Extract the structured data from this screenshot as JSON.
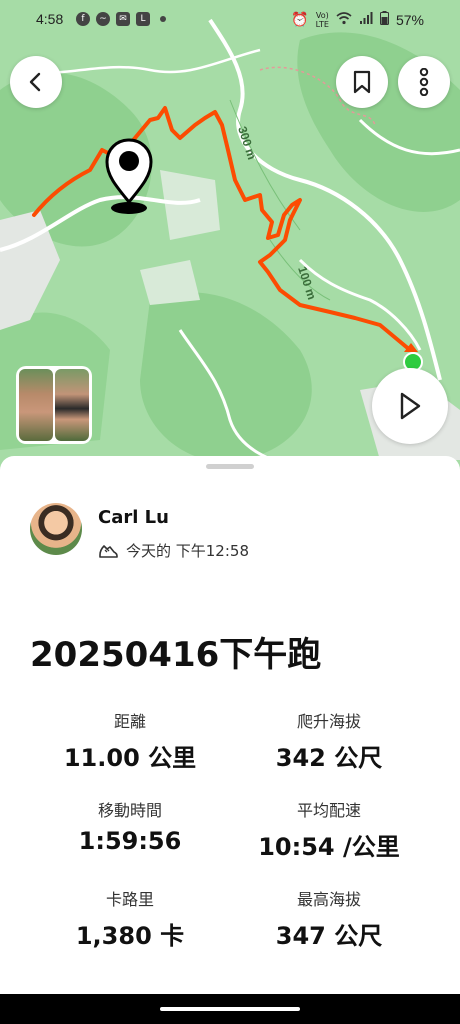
{
  "status_bar": {
    "time": "4:58",
    "battery": "57%",
    "left_icons": [
      "facebook-icon",
      "messenger-icon",
      "mail-icon",
      "line-icon",
      "dot-icon"
    ],
    "right_icons": [
      "alarm-icon",
      "volte-icon",
      "wifi-icon",
      "signal-icon",
      "battery-icon"
    ],
    "volte_label": "LTE"
  },
  "map": {
    "contour_labels": [
      "300 m",
      "100 m"
    ],
    "route_color": "#fc4c02",
    "start_marker_color": "#2ecc40",
    "base_color": "#a6dca6"
  },
  "header_buttons": {
    "back": "chevron-left-icon",
    "save": "bookmark-icon",
    "more": "more-vertical-icon",
    "play": "play-icon"
  },
  "athlete": {
    "name": "Carl Lu",
    "post_time": "今天的 下午12:58",
    "activity_type_icon": "shoe-icon"
  },
  "activity": {
    "title": "20250416下午跑"
  },
  "stats": [
    {
      "label": "距離",
      "value": "11.00 公里"
    },
    {
      "label": "爬升海拔",
      "value": "342 公尺"
    },
    {
      "label": "移動時間",
      "value": "1:59:56"
    },
    {
      "label": "平均配速",
      "value": "10:54 /公里"
    },
    {
      "label": "卡路里",
      "value": "1,380 卡"
    },
    {
      "label": "最高海拔",
      "value": "347 公尺"
    }
  ]
}
